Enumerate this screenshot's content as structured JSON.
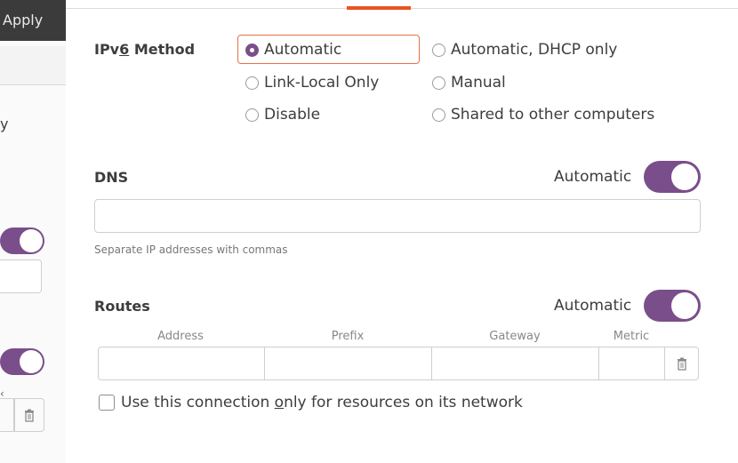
{
  "background_dialog": {
    "apply_label": "Apply",
    "partial_letter": "y",
    "partial_mark": "‹"
  },
  "ipv6": {
    "label_before": "IPv",
    "label_mnemonic": "6",
    "label_after": " Method",
    "selected": "Automatic",
    "options": [
      {
        "label": "Automatic",
        "selected": true
      },
      {
        "label": "Automatic, DHCP only",
        "selected": false
      },
      {
        "label": "Link-Local Only",
        "selected": false
      },
      {
        "label": "Manual",
        "selected": false
      },
      {
        "label": "Disable",
        "selected": false
      },
      {
        "label": "Shared to other computers",
        "selected": false
      }
    ]
  },
  "dns": {
    "label": "DNS",
    "automatic_label": "Automatic",
    "automatic_on": true,
    "value": "",
    "hint": "Separate IP addresses with commas"
  },
  "routes": {
    "label": "Routes",
    "automatic_label": "Automatic",
    "automatic_on": true,
    "columns": [
      "Address",
      "Prefix",
      "Gateway",
      "Metric"
    ],
    "row": {
      "address": "",
      "prefix": "",
      "gateway": "",
      "metric": ""
    }
  },
  "only_local": {
    "label_before": "Use this connection ",
    "label_mnemonic": "o",
    "label_after": "nly for resources on its network",
    "checked": false
  },
  "colors": {
    "accent": "#7a4e8a",
    "focus": "#e57248",
    "tab_indicator": "#e95420"
  }
}
